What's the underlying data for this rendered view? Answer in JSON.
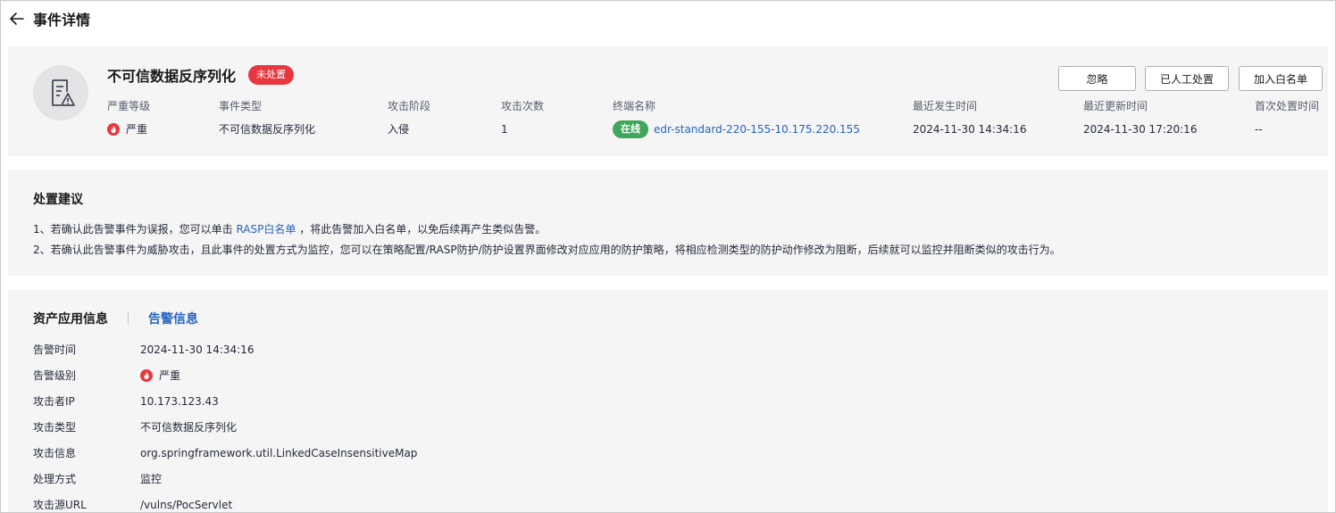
{
  "header": {
    "title": "事件详情"
  },
  "event": {
    "name": "不可信数据反序列化",
    "status": "未处置",
    "actions": {
      "ignore": "忽略",
      "manual": "已人工处置",
      "whitelist": "加入白名单"
    },
    "fields": {
      "severity": {
        "label": "严重等级",
        "value": "严重"
      },
      "type": {
        "label": "事件类型",
        "value": "不可信数据反序列化"
      },
      "stage": {
        "label": "攻击阶段",
        "value": "入侵"
      },
      "count": {
        "label": "攻击次数",
        "value": "1"
      },
      "endpoint": {
        "label": "终端名称",
        "status": "在线",
        "value": "edr-standard-220-155-10.175.220.155"
      },
      "last_time": {
        "label": "最近发生时间",
        "value": "2024-11-30 14:34:16"
      },
      "update_time": {
        "label": "最近更新时间",
        "value": "2024-11-30 17:20:16"
      },
      "first_handle": {
        "label": "首次处置时间",
        "value": "--"
      }
    }
  },
  "advice": {
    "title": "处置建议",
    "line1_prefix": "1、若确认此告警事件为误报，您可以单击 ",
    "line1_link": "RASP白名单",
    "line1_suffix": " ，将此告警加入白名单，以免后续再产生类似告警。",
    "line2": "2、若确认此告警事件为威胁攻击，且此事件的处置方式为监控，您可以在策略配置/RASP防护/防护设置界面修改对应应用的防护策略，将相应检测类型的防护动作修改为阻断，后续就可以监控并阻断类似的攻击行为。"
  },
  "info": {
    "tabs": {
      "assets": "资产应用信息",
      "alerts": "告警信息"
    },
    "rows": [
      {
        "label": "告警时间",
        "value": "2024-11-30 14:34:16"
      },
      {
        "label": "告警级别",
        "value": "严重"
      },
      {
        "label": "攻击者IP",
        "value": "10.173.123.43"
      },
      {
        "label": "攻击类型",
        "value": "不可信数据反序列化"
      },
      {
        "label": "攻击信息",
        "value": "org.springframework.util.LinkedCaseInsensitiveMap"
      },
      {
        "label": "处理方式",
        "value": "监控"
      },
      {
        "label": "攻击源URL",
        "value": "/vulns/PocServlet"
      }
    ]
  },
  "colors": {
    "accent": "#2463c2",
    "danger": "#e8373e",
    "online": "#3fa65c"
  },
  "icons": {
    "back": "arrow-left-icon",
    "event": "document-warning-icon",
    "severity": "flame-icon"
  }
}
